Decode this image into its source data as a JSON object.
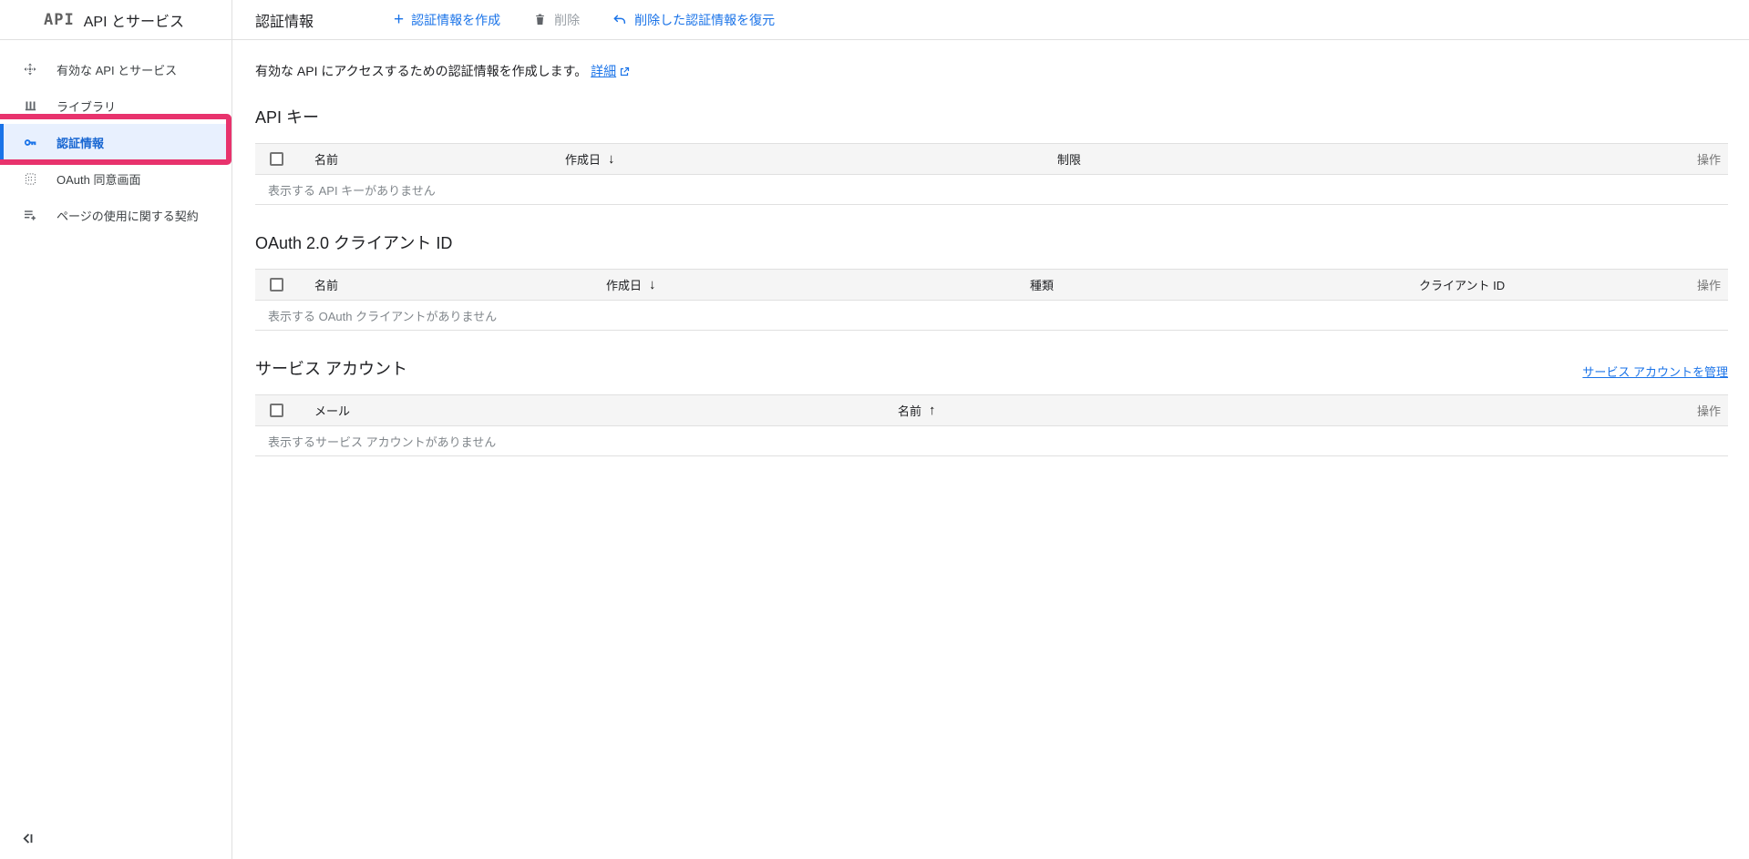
{
  "colors": {
    "accent_blue": "#1a73e8",
    "selected_text_blue": "#1967d2",
    "selected_item_bg": "#e8f0fe",
    "annotation_pink": "#e8336d",
    "table_header_bg": "#f5f5f5",
    "muted_text": "#80868b",
    "border": "#e0e0e0"
  },
  "sidebar": {
    "logo": "API",
    "title": "API とサービス",
    "items": [
      {
        "label": "有効な API とサービス",
        "icon": "enabled-apis-icon",
        "selected": false
      },
      {
        "label": "ライブラリ",
        "icon": "library-icon",
        "selected": false
      },
      {
        "label": "認証情報",
        "icon": "key-icon",
        "selected": true
      },
      {
        "label": "OAuth 同意画面",
        "icon": "oauth-consent-icon",
        "selected": false
      },
      {
        "label": "ページの使用に関する契約",
        "icon": "page-usage-agreements-icon",
        "selected": false
      }
    ],
    "collapse_icon": "collapse-sidebar-icon"
  },
  "topbar": {
    "title": "認証情報",
    "create_button": "認証情報を作成",
    "delete_button": "削除",
    "restore_button": "削除した認証情報を復元"
  },
  "intro": {
    "text": "有効な API にアクセスするための認証情報を作成します。",
    "link_label": "詳細"
  },
  "api_keys": {
    "title": "API キー",
    "columns": {
      "name": "名前",
      "created": "作成日",
      "restrictions": "制限",
      "actions": "操作"
    },
    "sort_arrow": "↓",
    "empty_message": "表示する API キーがありません"
  },
  "oauth_clients": {
    "title": "OAuth 2.0 クライアント ID",
    "columns": {
      "name": "名前",
      "created": "作成日",
      "type": "種類",
      "client_id": "クライアント ID",
      "actions": "操作"
    },
    "sort_arrow": "↓",
    "empty_message": "表示する OAuth クライアントがありません"
  },
  "service_accounts": {
    "title": "サービス アカウント",
    "manage_link": "サービス アカウントを管理",
    "columns": {
      "email": "メール",
      "name": "名前",
      "actions": "操作"
    },
    "sort_arrow": "↑",
    "empty_message": "表示するサービス アカウントがありません"
  }
}
